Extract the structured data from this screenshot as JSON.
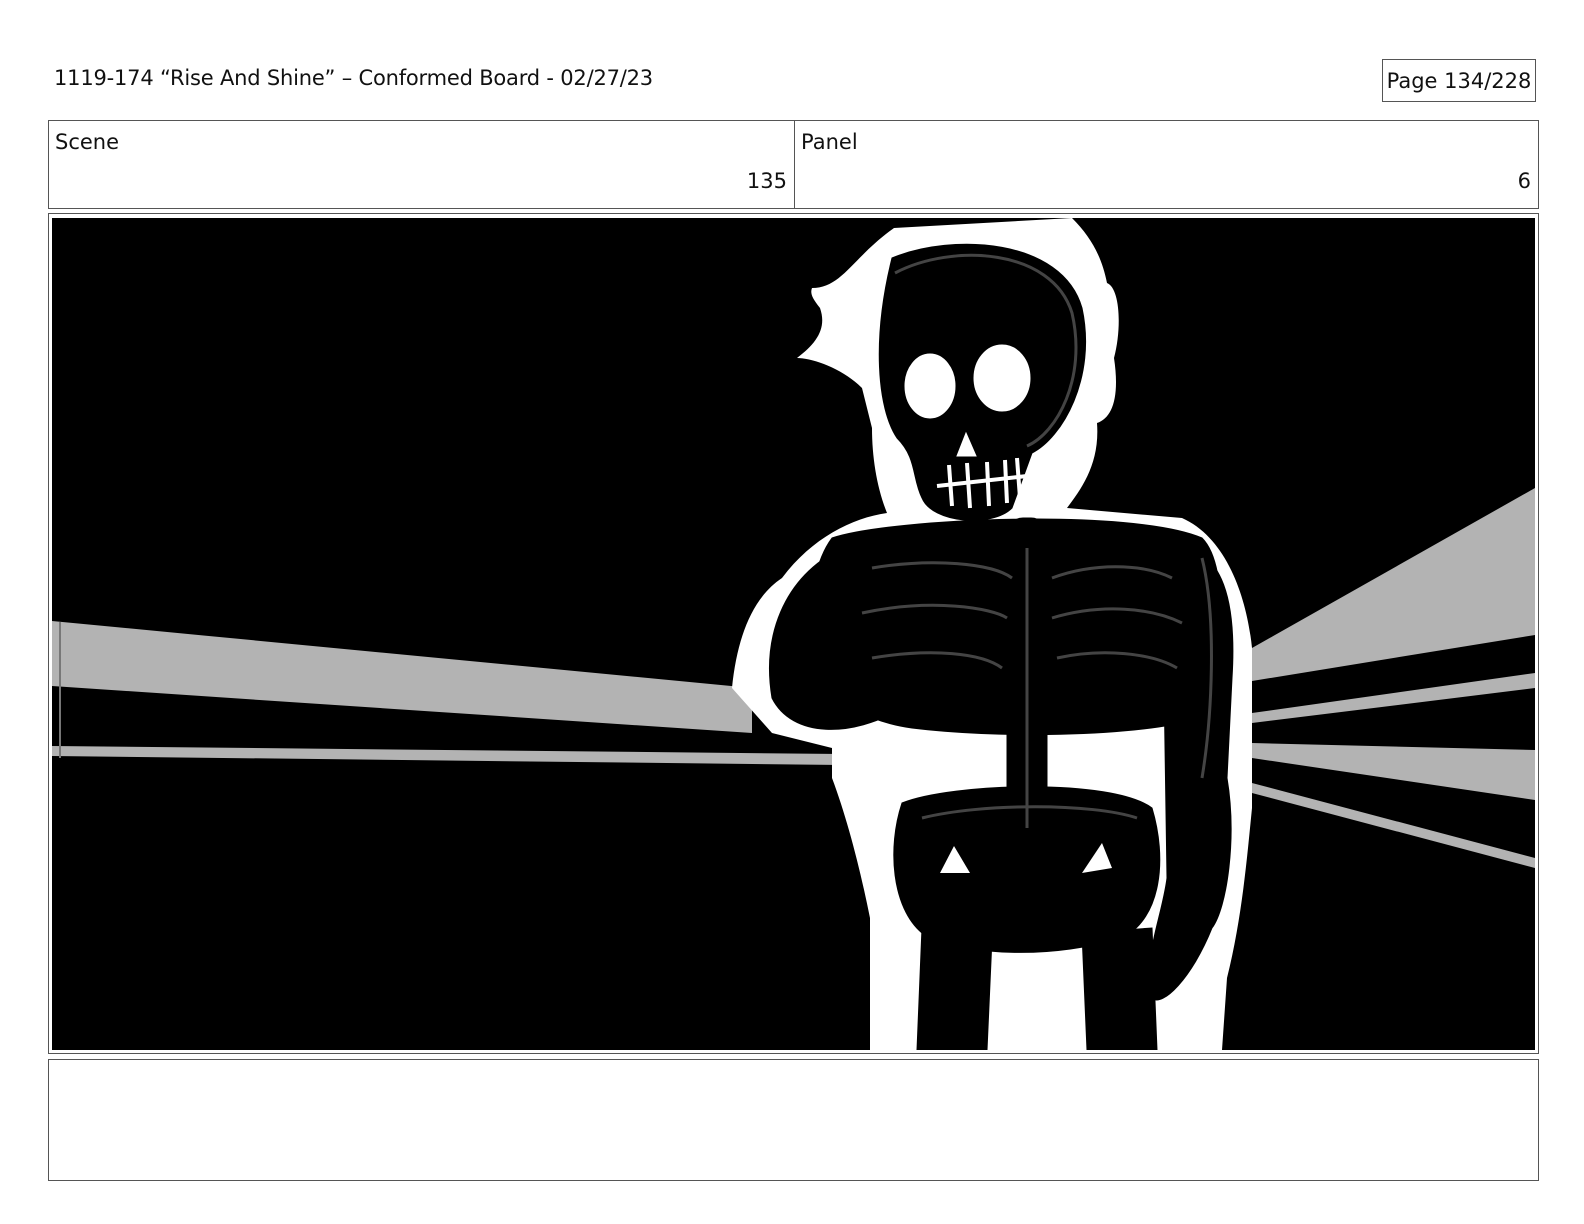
{
  "header": {
    "title": "1119-174 “Rise And Shine” – Conformed Board - 02/27/23",
    "page": "Page 134/228"
  },
  "info": {
    "scene_label": "Scene",
    "scene_value": "135",
    "panel_label": "Panel",
    "panel_value": "6"
  },
  "frame": {
    "background_color": "#000000",
    "beam_color": "#b3b3b3",
    "figure_outline_color": "#ffffff"
  },
  "notes": {
    "text": ""
  }
}
